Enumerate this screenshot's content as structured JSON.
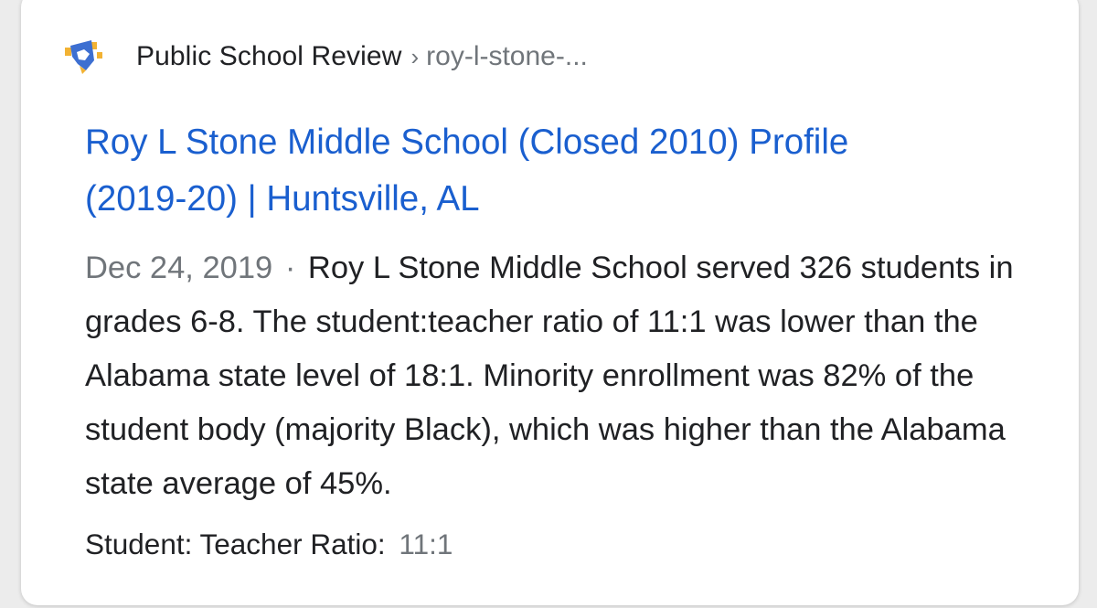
{
  "result": {
    "source_name": "Public School Review",
    "breadcrumb_separator": "›",
    "source_path": "roy-l-stone-...",
    "title_line1": "Roy L Stone Middle School (Closed 2010) Profile",
    "title_line2": "(2019-20) | Huntsville, AL",
    "date": "Dec 24, 2019",
    "date_separator": "·",
    "snippet": "Roy L Stone Middle School served 326 students in grades 6-8. The student:teacher ratio of 11:1 was lower than the Alabama state level of 18:1. Minority enrollment was 82% of the student body (majority Black), which was higher than the Alabama state average of 45%.",
    "stat_label": "Student: Teacher Ratio:",
    "stat_value": "11:1"
  },
  "icons": {
    "favicon": "public-school-review-logo"
  },
  "colors": {
    "link": "#1a5fcf",
    "text": "#202124",
    "muted": "#70757a",
    "logo_blue": "#3d6fd1",
    "logo_gold": "#f2b233"
  }
}
